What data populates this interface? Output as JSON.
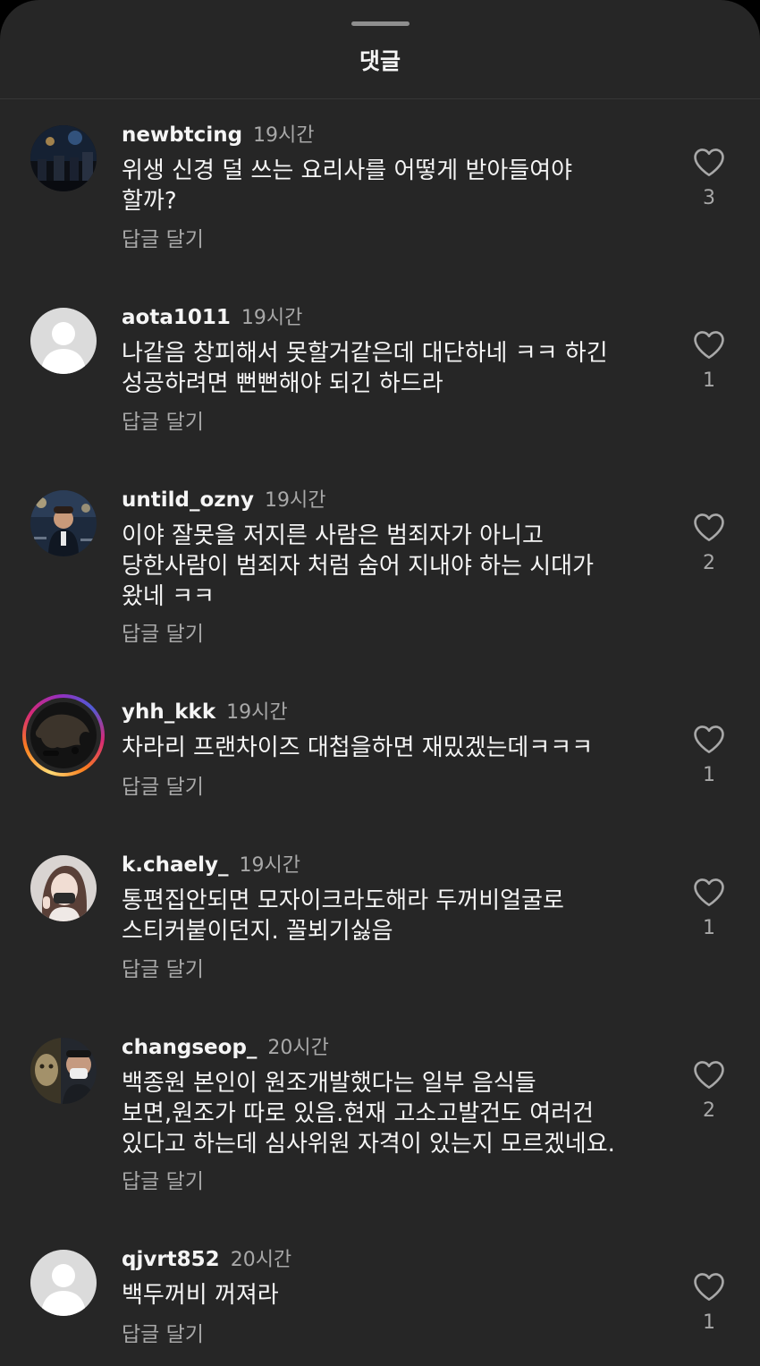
{
  "sheet": {
    "title": "댓글"
  },
  "comments": [
    {
      "username": "newbtcing",
      "time": "19시간",
      "text": "위생 신경 덜 쓰는 요리사를 어떻게 받아들여야\n할까?",
      "reply": "답글 달기",
      "likes": "3",
      "avatar": "photo-dark-crowd"
    },
    {
      "username": "aota1011",
      "time": "19시간",
      "text": "나같음 창피해서 못할거같은데 대단하네 ㅋㅋ 하긴\n성공하려면 뻔뻔해야 되긴 하드라",
      "reply": "답글 달기",
      "likes": "1",
      "avatar": "default-user"
    },
    {
      "username": "untild_ozny",
      "time": "19시간",
      "text": "이야 잘못을 저지른 사람은 범죄자가 아니고\n당한사람이 범죄자 처럼 숨어 지내야 하는 시대가\n왔네 ㅋㅋ",
      "reply": "답글 달기",
      "likes": "2",
      "avatar": "photo-man-suit"
    },
    {
      "username": "yhh_kkk",
      "time": "19시간",
      "text": "차라리 프랜차이즈 대첩을하면 재밌겠는데ㅋㅋㅋ",
      "reply": "답글 달기",
      "likes": "1",
      "avatar": "photo-story-ring"
    },
    {
      "username": "k.chaely_",
      "time": "19시간",
      "text": "통편집안되면 모자이크라도해라 두꺼비얼굴로\n스티커붙이던지. 꼴뵈기싫음",
      "reply": "답글 달기",
      "likes": "1",
      "avatar": "photo-woman"
    },
    {
      "username": "changseop_",
      "time": "20시간",
      "text": "백종원 본인이 원조개발했다는 일부 음식들\n보면,원조가 따로 있음.현재 고소고발건도 여러건\n있다고 하는데 심사위원 자격이 있는지 모르겠네요.",
      "reply": "답글 달기",
      "likes": "2",
      "avatar": "photo-two-faces"
    },
    {
      "username": "qjvrt852",
      "time": "20시간",
      "text": "백두꺼비 꺼져라",
      "reply": "답글 달기",
      "likes": "1",
      "avatar": "default-user"
    }
  ],
  "icons": {
    "like": "heart-outline-icon"
  },
  "colors": {
    "sheet_bg": "#262626",
    "primary_text": "#f5f5f5",
    "secondary_text": "#a8a8a8"
  }
}
